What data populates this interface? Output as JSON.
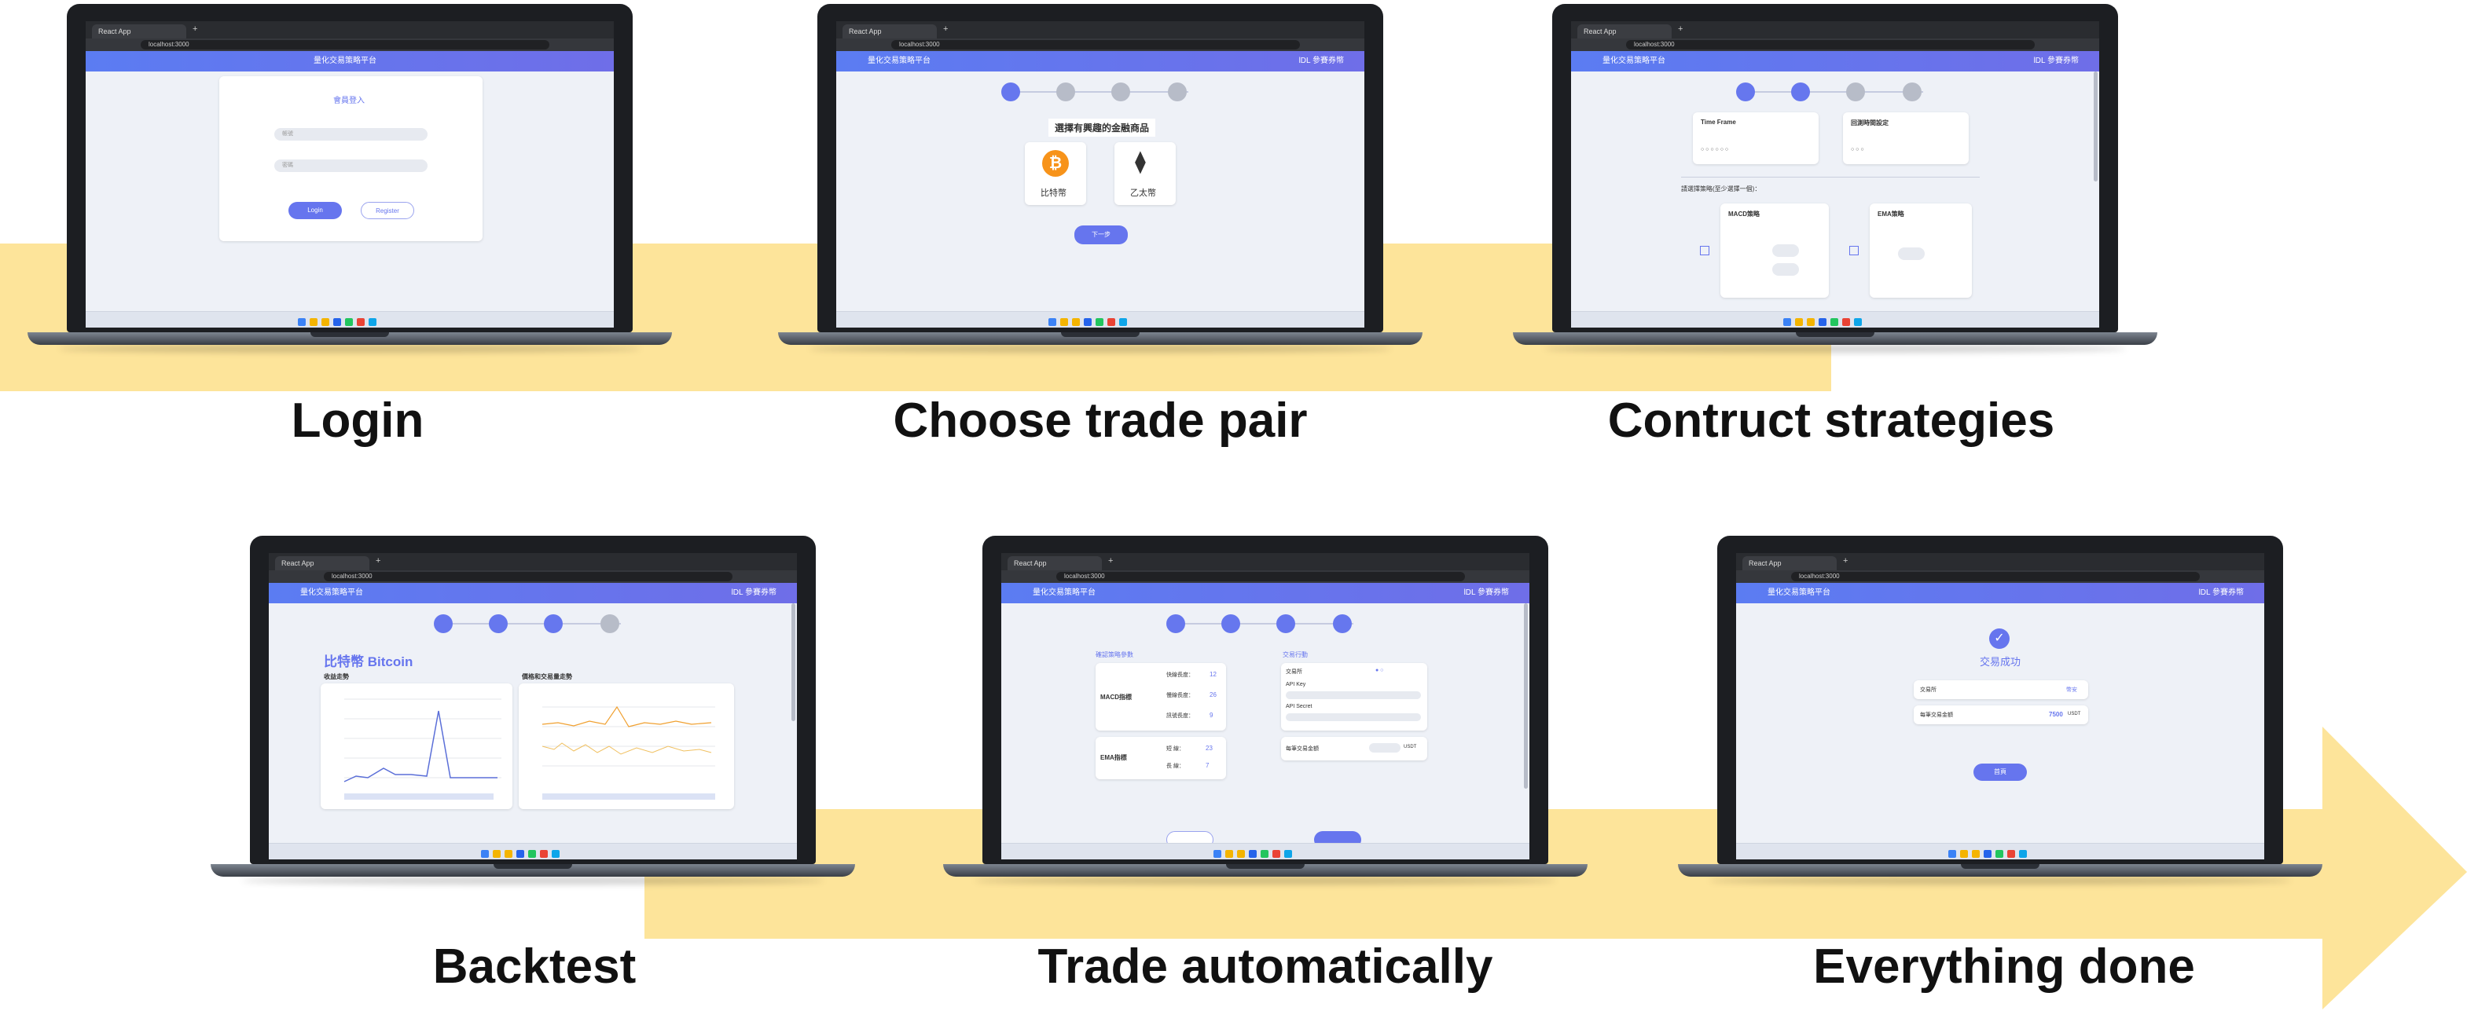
{
  "steps": [
    {
      "caption": "Login"
    },
    {
      "caption": "Choose trade pair"
    },
    {
      "caption": "Contruct strategies"
    },
    {
      "caption": "Backtest"
    },
    {
      "caption": "Trade automatically"
    },
    {
      "caption": "Everything done"
    }
  ],
  "browser": {
    "tab_title": "React App",
    "url": "localhost:3000"
  },
  "app": {
    "brand": "量化交易策略平台",
    "user_badge": "lDL 參賽券幣"
  },
  "login": {
    "title": "會員登入",
    "username_placeholder": "帳號",
    "password_placeholder": "密碼",
    "login_button": "Login",
    "register_button": "Register"
  },
  "choose": {
    "heading": "選擇有興趣的金融商品",
    "btc_label": "比特幣",
    "eth_label": "乙太幣",
    "next_button": "下一步"
  },
  "strategy": {
    "timeframe_title": "Time Frame",
    "backtest_title": "回測時間設定",
    "select_hint": "請選擇策略(至少選擇一個)：",
    "macd_title": "MACD策略",
    "ema_title": "EMA策略"
  },
  "backtest": {
    "coin_title": "比特幣 Bitcoin",
    "profit_chart_title": "收益走勢",
    "price_chart_title": "價格和交易量走勢"
  },
  "trade": {
    "confirm_title": "確認策略參數",
    "action_title": "交易行動",
    "macd_label": "MACD指標",
    "ema_label": "EMA指標",
    "fast_label": "快線長度：",
    "fast_value": "12",
    "slow_label": "慢線長度：",
    "slow_value": "26",
    "signal_label": "訊號長度：",
    "signal_value": "9",
    "short_label": "短 線：",
    "short_value": "23",
    "long_label": "長 線：",
    "long_value": "7",
    "exchange_label": "交易所",
    "api_key_label": "API Key",
    "api_secret_label": "API Secret",
    "amount_label": "每筆交易金額",
    "amount_unit": "USDT"
  },
  "done": {
    "success_title": "交易成功",
    "exchange_label": "交易所",
    "exchange_value": "幣安",
    "amount_label": "每筆交易金額",
    "amount_value": "7500",
    "amount_unit": "USDT",
    "home_button": "首頁"
  },
  "colors": {
    "arrow": "#fde49a",
    "accent": "#6675ee",
    "btc": "#f7931a"
  }
}
